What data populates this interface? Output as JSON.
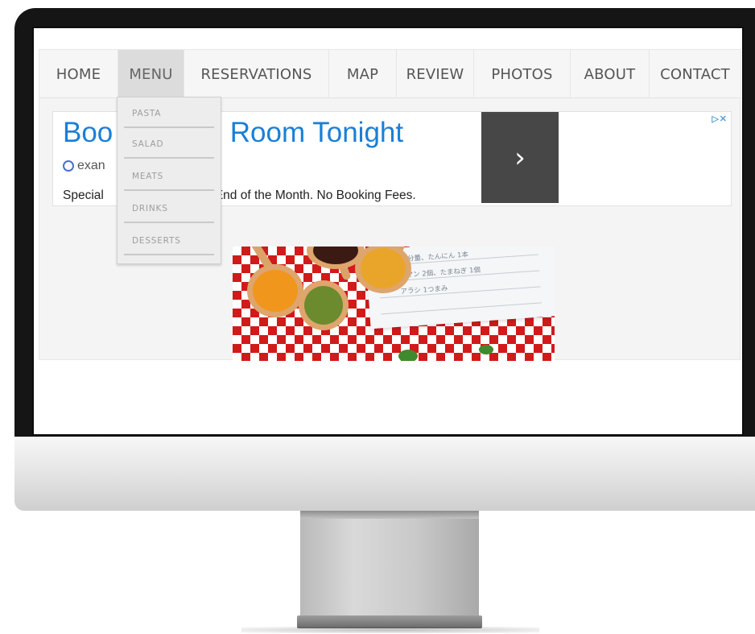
{
  "nav": {
    "items": [
      {
        "label": "HOME"
      },
      {
        "label": "MENU"
      },
      {
        "label": "RESERVATIONS"
      },
      {
        "label": "MAP"
      },
      {
        "label": "REVIEW"
      },
      {
        "label": "PHOTOS"
      },
      {
        "label": "ABOUT"
      },
      {
        "label": "CONTACT"
      }
    ],
    "active": "MENU"
  },
  "dropdown": {
    "items": [
      {
        "label": "PASTA"
      },
      {
        "label": "SALAD"
      },
      {
        "label": "MEATS"
      },
      {
        "label": "DRINKS"
      },
      {
        "label": "DESSERTS"
      }
    ]
  },
  "ad": {
    "title_left": "Boo",
    "title_right": "l Room Tonight",
    "url_prefix": "exan",
    "desc_left": "Special",
    "desc_right": "End of the Month. No Booking Fees.",
    "arrow_glyph": "›",
    "adchoices": "▷✕"
  },
  "image": {
    "paper_lines": [
      "ン 分量、たんにん 1本",
      "ーマン 2個、たまねぎ 1個",
      "アラシ 1つまみ"
    ]
  },
  "colors": {
    "accent": "#1a7fd6",
    "tablecloth": "#d11a1a",
    "ad_button": "#474747"
  }
}
